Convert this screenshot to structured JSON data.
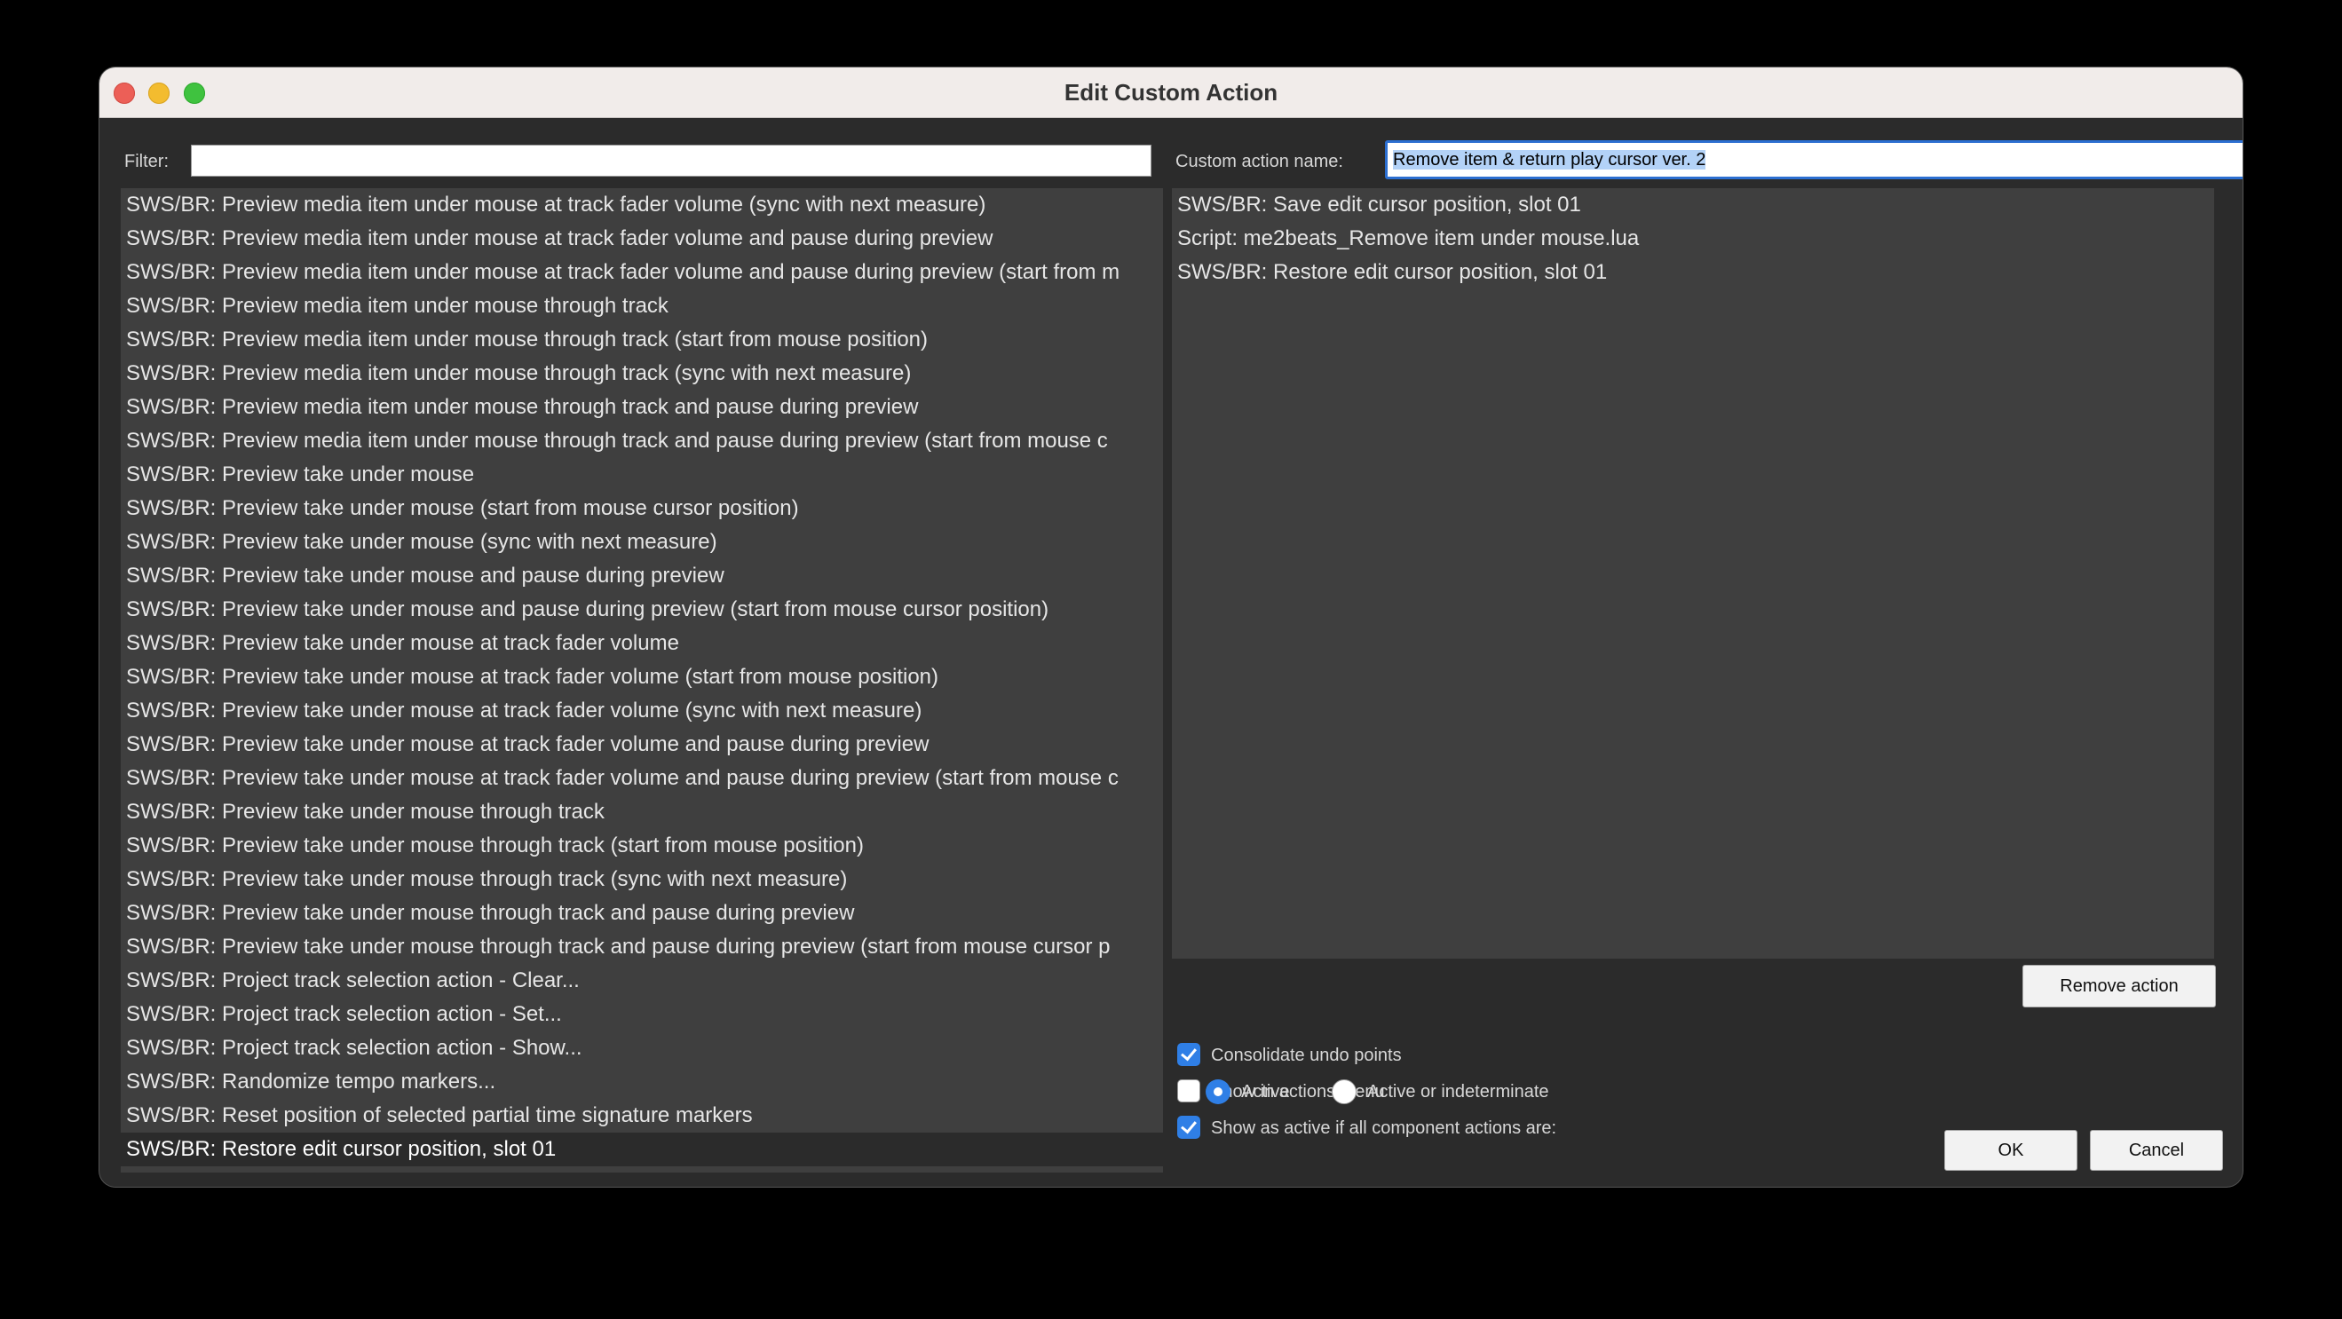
{
  "window": {
    "title": "Edit Custom Action"
  },
  "filter": {
    "label": "Filter:",
    "value": ""
  },
  "custom_name": {
    "label": "Custom action name:",
    "value": "Remove item & return play cursor ver. 2"
  },
  "available_actions": [
    "SWS/BR: Preview media item under mouse at track fader volume (sync with next measure)",
    "SWS/BR: Preview media item under mouse at track fader volume and pause during preview",
    "SWS/BR: Preview media item under mouse at track fader volume and pause during preview (start from m",
    "SWS/BR: Preview media item under mouse through track",
    "SWS/BR: Preview media item under mouse through track (start from mouse position)",
    "SWS/BR: Preview media item under mouse through track (sync with next measure)",
    "SWS/BR: Preview media item under mouse through track and pause during preview",
    "SWS/BR: Preview media item under mouse through track and pause during preview (start from mouse c",
    "SWS/BR: Preview take under mouse",
    "SWS/BR: Preview take under mouse (start from mouse cursor position)",
    "SWS/BR: Preview take under mouse (sync with next measure)",
    "SWS/BR: Preview take under mouse and pause during preview",
    "SWS/BR: Preview take under mouse and pause during preview (start from mouse cursor position)",
    "SWS/BR: Preview take under mouse at track fader volume",
    "SWS/BR: Preview take under mouse at track fader volume (start from mouse position)",
    "SWS/BR: Preview take under mouse at track fader volume (sync with next measure)",
    "SWS/BR: Preview take under mouse at track fader volume and pause during preview",
    "SWS/BR: Preview take under mouse at track fader volume and pause during preview (start from mouse c",
    "SWS/BR: Preview take under mouse through track",
    "SWS/BR: Preview take under mouse through track (start from mouse position)",
    "SWS/BR: Preview take under mouse through track (sync with next measure)",
    "SWS/BR: Preview take under mouse through track and pause during preview",
    "SWS/BR: Preview take under mouse through track and pause during preview (start from mouse cursor p",
    "SWS/BR: Project track selection action - Clear...",
    "SWS/BR: Project track selection action - Set...",
    "SWS/BR: Project track selection action - Show...",
    "SWS/BR: Randomize tempo markers...",
    "SWS/BR: Reset position of selected partial time signature markers",
    "SWS/BR: Restore edit cursor position, slot 01"
  ],
  "component_actions": [
    "SWS/BR: Save edit cursor position, slot 01",
    "Script: me2beats_Remove item under mouse.lua",
    "SWS/BR: Restore edit cursor position, slot 01"
  ],
  "options": {
    "consolidate_undo": {
      "label": "Consolidate undo points",
      "checked": true
    },
    "show_in_menu": {
      "label": "Show in actions menu",
      "checked": false
    },
    "show_active": {
      "label": "Show as active if all component actions are:",
      "checked": true
    }
  },
  "radios": {
    "active": {
      "label": "Active",
      "selected": true
    },
    "indeterminate": {
      "label": "Active or indeterminate",
      "selected": false
    }
  },
  "buttons": {
    "remove": "Remove action",
    "ok": "OK",
    "cancel": "Cancel"
  },
  "colors": {
    "accent": "#2f7fe6",
    "window_bg": "#2b2b2b",
    "list_bg": "#3f3f3f"
  }
}
